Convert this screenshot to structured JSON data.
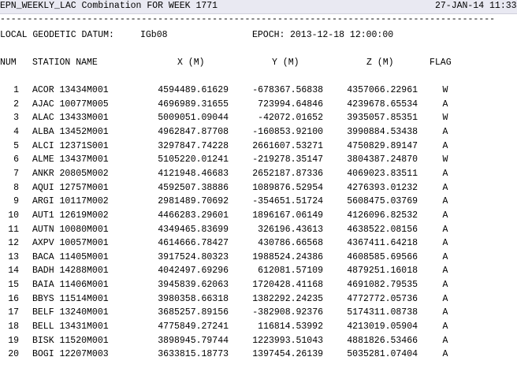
{
  "header": {
    "title": "EPN_WEEKLY_LAC Combination FOR WEEK 1771",
    "datetime": "27-JAN-14 11:33",
    "separator": "-------------------------------------------------------------------------------------------"
  },
  "datum": {
    "label": "LOCAL GEODETIC DATUM:",
    "value": "IGb08",
    "epoch_label": "EPOCH:",
    "epoch_value": "2013-12-18 12:00:00"
  },
  "columns": {
    "num": "NUM",
    "station": "STATION NAME",
    "x": "X (M)",
    "y": "Y (M)",
    "z": "Z (M)",
    "flag": "FLAG"
  },
  "rows": [
    {
      "num": "1",
      "name": "ACOR 13434M001",
      "x": "4594489.61629",
      "y": "-678367.56838",
      "z": "4357066.22961",
      "flag": "W"
    },
    {
      "num": "2",
      "name": "AJAC 10077M005",
      "x": "4696989.31655",
      "y": "723994.64846",
      "z": "4239678.65534",
      "flag": "A"
    },
    {
      "num": "3",
      "name": "ALAC 13433M001",
      "x": "5009051.09044",
      "y": "-42072.01652",
      "z": "3935057.85351",
      "flag": "W"
    },
    {
      "num": "4",
      "name": "ALBA 13452M001",
      "x": "4962847.87708",
      "y": "-160853.92100",
      "z": "3990884.53438",
      "flag": "A"
    },
    {
      "num": "5",
      "name": "ALCI 12371S001",
      "x": "3297847.74228",
      "y": "2661607.53271",
      "z": "4750829.89147",
      "flag": "A"
    },
    {
      "num": "6",
      "name": "ALME 13437M001",
      "x": "5105220.01241",
      "y": "-219278.35147",
      "z": "3804387.24870",
      "flag": "W"
    },
    {
      "num": "7",
      "name": "ANKR 20805M002",
      "x": "4121948.46683",
      "y": "2652187.87336",
      "z": "4069023.83511",
      "flag": "A"
    },
    {
      "num": "8",
      "name": "AQUI 12757M001",
      "x": "4592507.38886",
      "y": "1089876.52954",
      "z": "4276393.01232",
      "flag": "A"
    },
    {
      "num": "9",
      "name": "ARGI 10117M002",
      "x": "2981489.70692",
      "y": "-354651.51724",
      "z": "5608475.03769",
      "flag": "A"
    },
    {
      "num": "10",
      "name": "AUT1 12619M002",
      "x": "4466283.29601",
      "y": "1896167.06149",
      "z": "4126096.82532",
      "flag": "A"
    },
    {
      "num": "11",
      "name": "AUTN 10080M001",
      "x": "4349465.83699",
      "y": "326196.43613",
      "z": "4638522.08156",
      "flag": "A"
    },
    {
      "num": "12",
      "name": "AXPV 10057M001",
      "x": "4614666.78427",
      "y": "430786.66568",
      "z": "4367411.64218",
      "flag": "A"
    },
    {
      "num": "13",
      "name": "BACA 11405M001",
      "x": "3917524.80323",
      "y": "1988524.24386",
      "z": "4608585.69566",
      "flag": "A"
    },
    {
      "num": "14",
      "name": "BADH 14288M001",
      "x": "4042497.69296",
      "y": "612081.57109",
      "z": "4879251.16018",
      "flag": "A"
    },
    {
      "num": "15",
      "name": "BAIA 11406M001",
      "x": "3945839.62063",
      "y": "1720428.41168",
      "z": "4691082.79535",
      "flag": "A"
    },
    {
      "num": "16",
      "name": "BBYS 11514M001",
      "x": "3980358.66318",
      "y": "1382292.24235",
      "z": "4772772.05736",
      "flag": "A"
    },
    {
      "num": "17",
      "name": "BELF 13240M001",
      "x": "3685257.89156",
      "y": "-382908.92376",
      "z": "5174311.08738",
      "flag": "A"
    },
    {
      "num": "18",
      "name": "BELL 13431M001",
      "x": "4775849.27241",
      "y": "116814.53992",
      "z": "4213019.05904",
      "flag": "A"
    },
    {
      "num": "19",
      "name": "BISK 11520M001",
      "x": "3898945.79744",
      "y": "1223993.51043",
      "z": "4881826.53466",
      "flag": "A"
    },
    {
      "num": "20",
      "name": "BOGI 12207M003",
      "x": "3633815.18773",
      "y": "1397454.26139",
      "z": "5035281.07404",
      "flag": "A"
    }
  ]
}
